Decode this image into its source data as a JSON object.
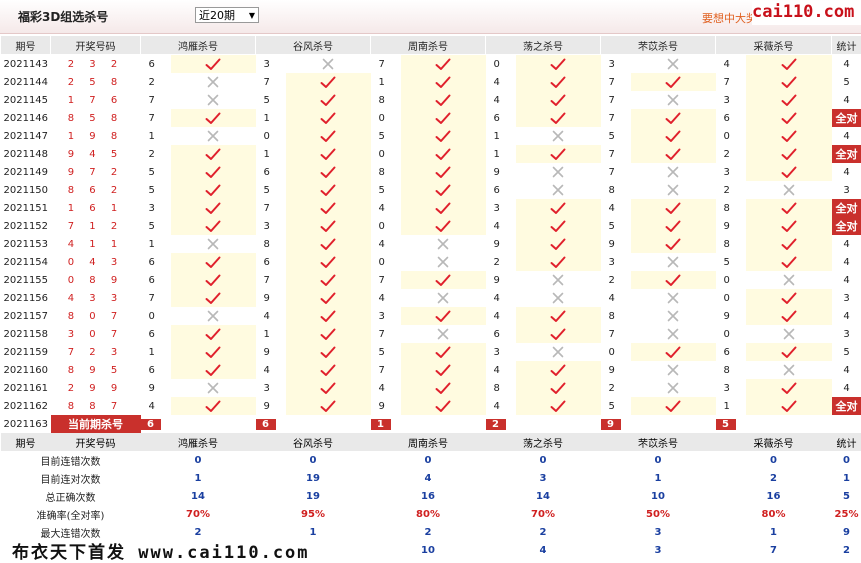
{
  "header": {
    "title": "福彩3D组选杀号",
    "period_select": "近20期",
    "promo": "要想中大奖",
    "logo": "cai110.com"
  },
  "columns": {
    "period": "期号",
    "number": "开奖号码",
    "count": "统计",
    "methods": [
      "鸿雁杀号",
      "谷风杀号",
      "周南杀号",
      "荡之杀号",
      "芣苡杀号",
      "采薇杀号"
    ]
  },
  "rows": [
    {
      "p": "2021143",
      "n": "2 3 2",
      "v": [
        "6",
        "3",
        "7",
        "0",
        "3",
        "4"
      ],
      "m": [
        1,
        0,
        1,
        1,
        0,
        1
      ],
      "c": "4"
    },
    {
      "p": "2021144",
      "n": "2 5 8",
      "v": [
        "2",
        "7",
        "1",
        "4",
        "7",
        "7"
      ],
      "m": [
        0,
        1,
        1,
        1,
        1,
        1
      ],
      "c": "5"
    },
    {
      "p": "2021145",
      "n": "1 7 6",
      "v": [
        "7",
        "5",
        "8",
        "4",
        "7",
        "3"
      ],
      "m": [
        0,
        1,
        1,
        1,
        0,
        1
      ],
      "c": "4"
    },
    {
      "p": "2021146",
      "n": "8 5 8",
      "v": [
        "7",
        "1",
        "0",
        "6",
        "7",
        "6"
      ],
      "m": [
        1,
        1,
        1,
        1,
        1,
        1
      ],
      "c": "全对"
    },
    {
      "p": "2021147",
      "n": "1 9 8",
      "v": [
        "1",
        "0",
        "5",
        "1",
        "5",
        "0"
      ],
      "m": [
        0,
        1,
        1,
        0,
        1,
        1
      ],
      "c": "4"
    },
    {
      "p": "2021148",
      "n": "9 4 5",
      "v": [
        "2",
        "1",
        "0",
        "1",
        "7",
        "2"
      ],
      "m": [
        1,
        1,
        1,
        1,
        1,
        1
      ],
      "c": "全对"
    },
    {
      "p": "2021149",
      "n": "9 7 2",
      "v": [
        "5",
        "6",
        "8",
        "9",
        "7",
        "3"
      ],
      "m": [
        1,
        1,
        1,
        0,
        0,
        1
      ],
      "c": "4"
    },
    {
      "p": "2021150",
      "n": "8 6 2",
      "v": [
        "5",
        "5",
        "5",
        "6",
        "8",
        "2"
      ],
      "m": [
        1,
        1,
        1,
        0,
        0,
        0
      ],
      "c": "3"
    },
    {
      "p": "2021151",
      "n": "1 6 1",
      "v": [
        "3",
        "7",
        "4",
        "3",
        "4",
        "8"
      ],
      "m": [
        1,
        1,
        1,
        1,
        1,
        1
      ],
      "c": "全对"
    },
    {
      "p": "2021152",
      "n": "7 1 2",
      "v": [
        "5",
        "3",
        "0",
        "4",
        "5",
        "9"
      ],
      "m": [
        1,
        1,
        1,
        1,
        1,
        1
      ],
      "c": "全对"
    },
    {
      "p": "2021153",
      "n": "4 1 1",
      "v": [
        "1",
        "8",
        "4",
        "9",
        "9",
        "8"
      ],
      "m": [
        0,
        1,
        0,
        1,
        1,
        1
      ],
      "c": "4"
    },
    {
      "p": "2021154",
      "n": "0 4 3",
      "v": [
        "6",
        "6",
        "0",
        "2",
        "3",
        "5"
      ],
      "m": [
        1,
        1,
        0,
        1,
        0,
        1
      ],
      "c": "4"
    },
    {
      "p": "2021155",
      "n": "0 8 9",
      "v": [
        "6",
        "7",
        "7",
        "9",
        "2",
        "0"
      ],
      "m": [
        1,
        1,
        1,
        0,
        1,
        0
      ],
      "c": "4"
    },
    {
      "p": "2021156",
      "n": "4 3 3",
      "v": [
        "7",
        "9",
        "4",
        "4",
        "4",
        "0"
      ],
      "m": [
        1,
        1,
        0,
        0,
        0,
        1
      ],
      "c": "3"
    },
    {
      "p": "2021157",
      "n": "8 0 7",
      "v": [
        "0",
        "4",
        "3",
        "4",
        "8",
        "9"
      ],
      "m": [
        0,
        1,
        1,
        1,
        0,
        1
      ],
      "c": "4"
    },
    {
      "p": "2021158",
      "n": "3 0 7",
      "v": [
        "6",
        "1",
        "7",
        "6",
        "7",
        "0"
      ],
      "m": [
        1,
        1,
        0,
        1,
        0,
        0
      ],
      "c": "3"
    },
    {
      "p": "2021159",
      "n": "7 2 3",
      "v": [
        "1",
        "9",
        "5",
        "3",
        "0",
        "6"
      ],
      "m": [
        1,
        1,
        1,
        0,
        1,
        1
      ],
      "c": "5"
    },
    {
      "p": "2021160",
      "n": "8 9 5",
      "v": [
        "6",
        "4",
        "7",
        "4",
        "9",
        "8"
      ],
      "m": [
        1,
        1,
        1,
        1,
        0,
        0
      ],
      "c": "4"
    },
    {
      "p": "2021161",
      "n": "2 9 9",
      "v": [
        "9",
        "3",
        "4",
        "8",
        "2",
        "3"
      ],
      "m": [
        0,
        1,
        1,
        1,
        0,
        1
      ],
      "c": "4"
    },
    {
      "p": "2021162",
      "n": "8 8 7",
      "v": [
        "4",
        "9",
        "9",
        "4",
        "5",
        "1"
      ],
      "m": [
        1,
        1,
        1,
        1,
        1,
        1
      ],
      "c": "全对"
    }
  ],
  "current": {
    "p": "2021163",
    "label": "当前期杀号",
    "v": [
      "6",
      "6",
      "1",
      "2",
      "9",
      "5"
    ]
  },
  "stats": [
    {
      "label": "目前连错次数",
      "v": [
        "0",
        "0",
        "0",
        "0",
        "0",
        "0",
        "0"
      ],
      "red": false
    },
    {
      "label": "目前连对次数",
      "v": [
        "1",
        "19",
        "4",
        "3",
        "1",
        "2",
        "1"
      ],
      "red": false
    },
    {
      "label": "总正确次数",
      "v": [
        "14",
        "19",
        "16",
        "14",
        "10",
        "16",
        "5"
      ],
      "red": false
    },
    {
      "label": "准确率(全对率)",
      "v": [
        "70%",
        "95%",
        "80%",
        "70%",
        "50%",
        "80%",
        "25%"
      ],
      "red": true
    },
    {
      "label": "最大连错次数",
      "v": [
        "2",
        "1",
        "2",
        "2",
        "3",
        "1",
        "9"
      ],
      "red": false
    },
    {
      "label": "",
      "v": [
        "",
        "",
        "10",
        "4",
        "3",
        "7",
        "2"
      ],
      "red": false
    }
  ],
  "watermark": "布衣天下首发 www.cai110.com",
  "colors": {
    "accent": "#c9302c",
    "check": "#e0202c",
    "cross": "#b8b8b8",
    "stat_blue": "#1a3fa0"
  }
}
